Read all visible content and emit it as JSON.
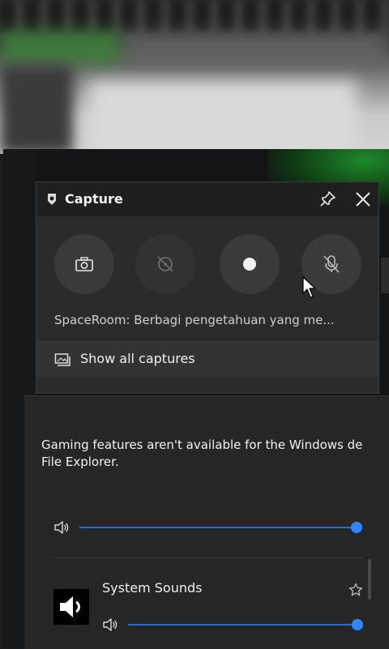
{
  "capture": {
    "title": "Capture",
    "now_playing": "SpaceRoom: Berbagi pengetahuan yang me...",
    "show_all_label": "Show all captures",
    "buttons": [
      {
        "icon": "camera-icon"
      },
      {
        "icon": "record-last-icon"
      },
      {
        "icon": "record-icon"
      },
      {
        "icon": "mic-off-icon"
      }
    ]
  },
  "audio": {
    "notice": "Gaming features aren't available for the Windows de File Explorer.",
    "notice_line1": "Gaming features aren't available for the Windows de",
    "notice_line2": "File Explorer.",
    "master_volume": 1.0,
    "apps": [
      {
        "name": "System Sounds",
        "volume": 1.0
      }
    ]
  },
  "colors": {
    "accent": "#1f6fd6",
    "thumb": "#2f86ff"
  }
}
